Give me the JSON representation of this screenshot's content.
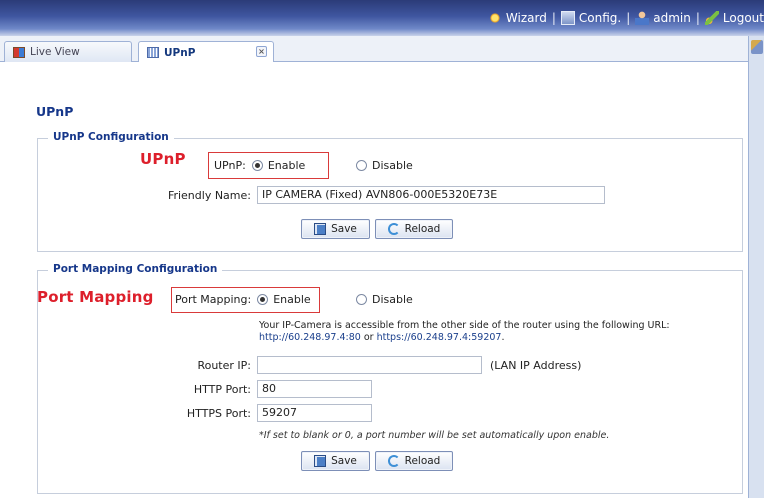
{
  "topnav": {
    "wizard": "Wizard",
    "config": "Config.",
    "admin": "admin",
    "logout": "Logout",
    "separator": "|"
  },
  "tabs": [
    {
      "label": "Live View"
    },
    {
      "label": "UPnP",
      "close": "×"
    }
  ],
  "page": {
    "title": "UPnP"
  },
  "upnp_section": {
    "legend": "UPnP Configuration",
    "annotation": "UPnP",
    "upnp_label": "UPnP:",
    "enable_label": "Enable",
    "disable_label": "Disable",
    "selected": "Enable",
    "friendly_name_label": "Friendly Name:",
    "friendly_name_value": "IP CAMERA (Fixed) AVN806-000E5320E73E",
    "save_label": "Save",
    "reload_label": "Reload"
  },
  "port_section": {
    "legend": "Port Mapping Configuration",
    "annotation": "Port Mapping",
    "port_mapping_label": "Port Mapping:",
    "enable_label": "Enable",
    "disable_label": "Disable",
    "selected": "Enable",
    "info_line1": "Your IP-Camera is accessible from the other side of the router using the following URL:",
    "url_http": "http://60.248.97.4:80",
    "url_or": " or ",
    "url_https": "https://60.248.97.4:59207",
    "url_end": ".",
    "router_ip_label": "Router IP:",
    "router_ip_value": "",
    "lan_hint": "(LAN IP Address)",
    "http_port_label": "HTTP Port:",
    "http_port_value": "80",
    "https_port_label": "HTTPS Port:",
    "https_port_value": "59207",
    "note": "*If set to blank or 0, a port number will be set automatically upon enable.",
    "save_label": "Save",
    "reload_label": "Reload"
  },
  "colors": {
    "annotation_red": "#dd1f2b",
    "section_title_blue": "#16378a",
    "topbar_blue": "#3f56a0"
  }
}
